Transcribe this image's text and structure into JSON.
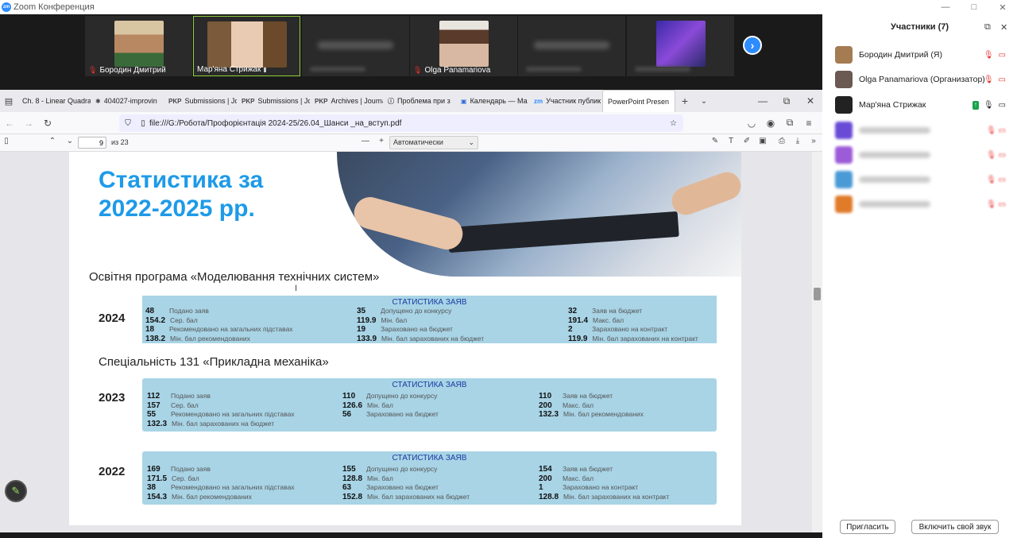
{
  "window": {
    "title": "Zoom Конференция",
    "logo": "zm"
  },
  "video_strip": {
    "tiles": [
      {
        "name": "Бородин Дмитрий",
        "muted": true
      },
      {
        "name": "Мар'яна Стрижак",
        "muted": false,
        "active": true
      },
      {
        "name": "",
        "muted": true,
        "blurred": true
      },
      {
        "name": "Olga Panamariova",
        "muted": true
      },
      {
        "name": "",
        "muted": true,
        "blurred": true
      },
      {
        "name": "",
        "muted": true,
        "avatar": true
      }
    ]
  },
  "browser": {
    "tabs": [
      {
        "label": "Ch. 8 - Linear Quadrat",
        "icon": "Ch"
      },
      {
        "label": "404027-improvin",
        "icon": "✱"
      },
      {
        "label": "Submissions | Jou",
        "icon": "PKP"
      },
      {
        "label": "Submissions | Jou",
        "icon": "PKP"
      },
      {
        "label": "Archives | Journal",
        "icon": "PKP"
      },
      {
        "label": "Проблема при з",
        "icon": "ⓘ"
      },
      {
        "label": "Календарь — Ма",
        "icon": "▣"
      },
      {
        "label": "Участник публик",
        "icon": "zm"
      },
      {
        "label": "PowerPoint Presen",
        "icon": "",
        "active": true
      }
    ],
    "url": "file:///G:/Робота/Профорієнтація 2024-25/26.04_Шанси _на_вступ.pdf",
    "pdf": {
      "page": "9",
      "of_label": "из 23",
      "zoom": "Автоматически"
    }
  },
  "slide": {
    "title_line1": "Статистика за",
    "title_line2": "2022-2025 рр.",
    "section1": "Освітня програма «Моделювання технічних систем»",
    "section2": "Спеціальність 131 «Прикладна механіка»",
    "blocks": [
      {
        "year": "2024",
        "header": "СТАТИСТИКА ЗАЯВ",
        "cols": [
          [
            [
              "48",
              "Подано заяв"
            ],
            [
              "154.2",
              "Сер. бал"
            ],
            [
              "18",
              "Рекомендовано на загальних підставах"
            ],
            [
              "138.2",
              "Мін. бал рекомендованих"
            ]
          ],
          [
            [
              "35",
              "Допущено до конкурсу"
            ],
            [
              "119.9",
              "Мін. бал"
            ],
            [
              "19",
              "Зараховано на бюджет"
            ],
            [
              "133.9",
              "Мін. бал зарахованих на бюджет"
            ]
          ],
          [
            [
              "32",
              "Заяв на бюджет"
            ],
            [
              "191.4",
              "Макс. бал"
            ],
            [
              "2",
              "Зараховано на контракт"
            ],
            [
              "119.9",
              "Мін. бал зарахованих на контракт"
            ]
          ]
        ]
      },
      {
        "year": "2023",
        "header": "СТАТИСТИКА ЗАЯВ",
        "cols": [
          [
            [
              "112",
              "Подано заяв"
            ],
            [
              "157",
              "Сер. бал"
            ],
            [
              "55",
              "Рекомендовано на загальних підставах"
            ],
            [
              "132.3",
              "Мін. бал зарахованих на бюджет"
            ]
          ],
          [
            [
              "110",
              "Допущено до конкурсу"
            ],
            [
              "126.6",
              "Мін. бал"
            ],
            [
              "56",
              "Зараховано на бюджет"
            ]
          ],
          [
            [
              "110",
              "Заяв на бюджет"
            ],
            [
              "200",
              "Макс. бал"
            ],
            [
              "132.3",
              "Мін. бал рекомендованих"
            ]
          ]
        ]
      },
      {
        "year": "2022",
        "header": "СТАТИСТИКА ЗАЯВ",
        "cols": [
          [
            [
              "169",
              "Подано заяв"
            ],
            [
              "171.5",
              "Сер. бал"
            ],
            [
              "38",
              "Рекомендовано на загальних підставах"
            ],
            [
              "154.3",
              "Мін. бал рекомендованих"
            ]
          ],
          [
            [
              "155",
              "Допущено до конкурсу"
            ],
            [
              "128.8",
              "Мін. бал"
            ],
            [
              "63",
              "Зараховано на бюджет"
            ],
            [
              "152.8",
              "Мін. бал зарахованих на бюджет"
            ]
          ],
          [
            [
              "154",
              "Заяв на бюджет"
            ],
            [
              "200",
              "Макс. бал"
            ],
            [
              "1",
              "Зараховано на контракт"
            ],
            [
              "128.8",
              "Мін. бал зарахованих на контракт"
            ]
          ]
        ]
      }
    ]
  },
  "participants": {
    "header": "Участники (7)",
    "list": [
      {
        "name": "Бородин Дмитрий (Я)",
        "color": "#a57b52"
      },
      {
        "name": "Olga Panamariova (Организатор)",
        "color": "#6b5a52"
      },
      {
        "name": "Мар'яна Стрижак",
        "color": "#222222"
      }
    ],
    "blurred_colors": [
      "#6a4bd6",
      "#9c5bd8",
      "#4a9ad6",
      "#e07b2a"
    ],
    "invite_label": "Пригласить",
    "audio_label": "Включить свой звук"
  },
  "colors": {
    "accent": "#2d8cff",
    "slide_title": "#1e9ae8",
    "stat_box": "#a8d4e6",
    "mute": "#e5312b"
  }
}
